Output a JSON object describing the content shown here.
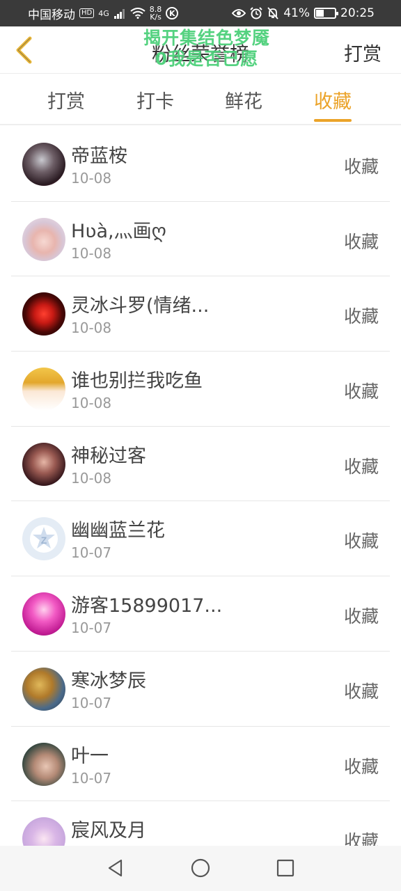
{
  "status_bar": {
    "carrier": "中国移动",
    "hd_badge": "HD",
    "network": "4G",
    "speed_value": "8.8",
    "speed_unit": "K/s",
    "k_icon_label": "K",
    "battery": "41%",
    "battery_level": 0.41,
    "time": "20:25"
  },
  "header": {
    "title": "粉丝荣誉榜",
    "overlay_line1": "揭开集结色梦魇",
    "overlay_line2": "0我是否已愿",
    "reward_link": "打赏"
  },
  "tabs": [
    {
      "label": "打赏",
      "active": false
    },
    {
      "label": "打卡",
      "active": false
    },
    {
      "label": "鲜花",
      "active": false
    },
    {
      "label": "收藏",
      "active": true
    }
  ],
  "rows": [
    {
      "name": "帝蓝桉",
      "date": "10-08",
      "action": "收藏"
    },
    {
      "name": "Hʋà,灬画ღ",
      "date": "10-08",
      "action": "收藏"
    },
    {
      "name": "灵冰斗罗(情绪...",
      "date": "10-08",
      "action": "收藏"
    },
    {
      "name": "谁也别拦我吃鱼",
      "date": "10-08",
      "action": "收藏"
    },
    {
      "name": "神秘过客",
      "date": "10-08",
      "action": "收藏"
    },
    {
      "name": "幽幽蓝兰花",
      "date": "10-07",
      "action": "收藏"
    },
    {
      "name": "游客15899017...",
      "date": "10-07",
      "action": "收藏"
    },
    {
      "name": "寒冰梦辰",
      "date": "10-07",
      "action": "收藏"
    },
    {
      "name": "叶一",
      "date": "10-07",
      "action": "收藏"
    },
    {
      "name": "宸风及月",
      "date": "",
      "action": "收藏"
    }
  ],
  "colors": {
    "accent": "#eba329",
    "status_bar_bg": "#3a3a3a",
    "overlay_text": "#4cd07a"
  }
}
